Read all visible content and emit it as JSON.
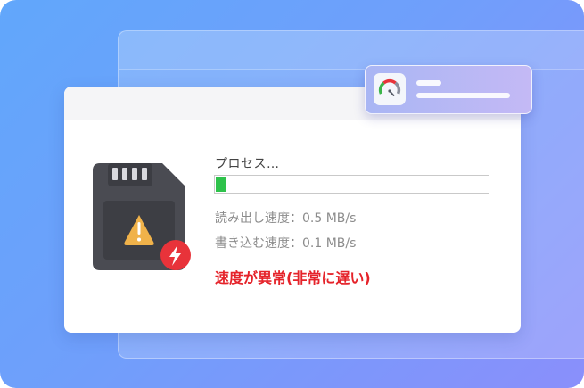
{
  "status": {
    "process_label": "プロセス…",
    "progress": 0.04,
    "read_speed": "読み出し速度：0.5 MB/s",
    "write_speed": "書き込む速度：0.1 MB/s",
    "alert": "速度が異常(非常に遅い)"
  },
  "colors": {
    "progress_fill": "#2ec24b",
    "alert": "#e5232a",
    "warning_badge": "#e8333a",
    "warning_triangle": "#f0b24a"
  },
  "icons": {
    "card": "sd-card-icon",
    "warning": "warning-triangle-icon",
    "lightning": "lightning-icon",
    "speedometer": "speedometer-icon"
  }
}
